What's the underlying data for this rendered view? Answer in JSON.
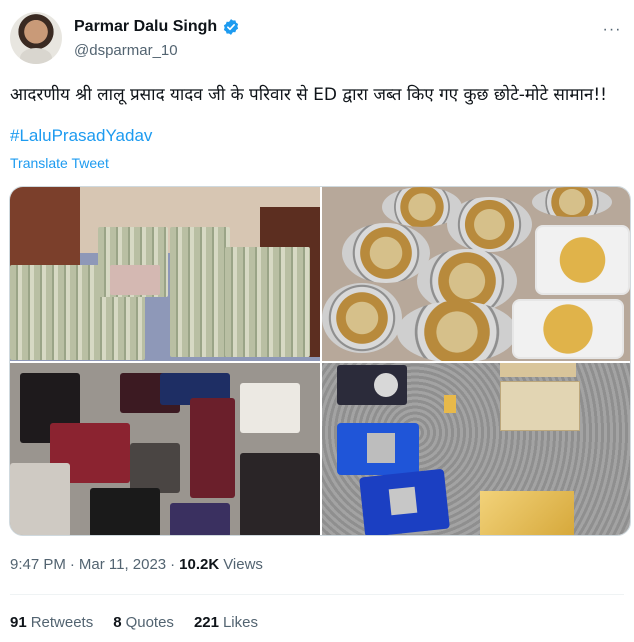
{
  "author": {
    "display_name": "Parmar Dalu Singh",
    "handle": "@dsparmar_10"
  },
  "tweet": {
    "text": "आदरणीय श्री लालू प्रसाद यादव जी के परिवार से ED द्वारा जब्त किए गए कुछ छोटे-मोटे सामान!!",
    "hashtag": "#LaluPrasadYadav",
    "translate_label": "Translate Tweet"
  },
  "meta": {
    "time": "9:47 PM",
    "separator": "·",
    "date": "Mar 11, 2023",
    "views_count": "10.2K",
    "views_label": "Views"
  },
  "stats": {
    "retweets_count": "91",
    "retweets_label": "Retweets",
    "quotes_count": "8",
    "quotes_label": "Quotes",
    "likes_count": "221",
    "likes_label": "Likes"
  },
  "icons": [
    "verified-badge-icon",
    "more-options-icon"
  ],
  "colors": {
    "link": "#1d9bf0",
    "secondary_text": "#536471",
    "primary_text": "#0f1419"
  }
}
